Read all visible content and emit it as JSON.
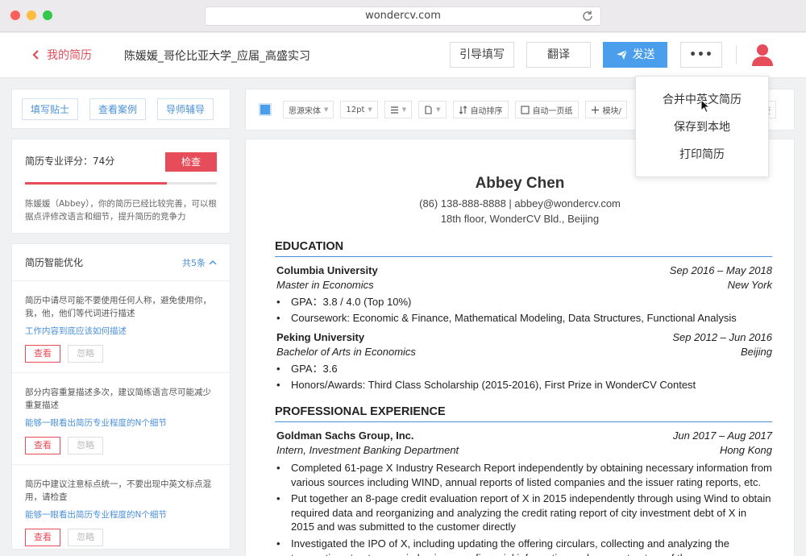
{
  "browser": {
    "url": "wondercv.com"
  },
  "header": {
    "back_label": "我的简历",
    "doc_title": "陈媛媛_哥伦比亚大学_应届_高盛实习",
    "guide_label": "引导填写",
    "translate_label": "翻译",
    "send_label": "发送",
    "more_label": "•••"
  },
  "dropdown": {
    "items": [
      "合并中英文简历",
      "保存到本地",
      "打印简历"
    ]
  },
  "left": {
    "tabs": [
      "填写贴士",
      "查看案例",
      "导师辅导"
    ],
    "score": {
      "label": "简历专业评分：74分",
      "value": 74,
      "check_label": "检查",
      "desc": "陈媛媛（Abbey），你的简历已经比较完善，可以根据点评修改语言和细节，提升简历的竞争力"
    },
    "optimize": {
      "title": "简历智能优化",
      "count": "共5条",
      "items": [
        {
          "text": "简历中请尽可能不要使用任何人称，避免使用你，我，他，他们等代词进行描述",
          "link": "工作内容到底应该如何描述",
          "view": "查看",
          "ignore": "忽略"
        },
        {
          "text": "部分内容重复描述多次，建议简练语言尽可能减少重复描述",
          "link": "能够一眼看出简历专业程度的N个细节",
          "view": "查看",
          "ignore": "忽略"
        },
        {
          "text": "简历中建议注意标点统一，不要出现中英文标点混用，请检查",
          "link": "能够一眼看出简历专业程度的N个细节",
          "view": "查看",
          "ignore": "忽略"
        }
      ]
    }
  },
  "toolbar": {
    "font": "思源宋体",
    "size": "12pt",
    "auto_sort": "自动排序",
    "auto_page": "自动一页纸",
    "module": "模块/",
    "last": "查"
  },
  "resume": {
    "name": "Abbey Chen",
    "contact1": "(86) 138-888-8888 | abbey@wondercv.com",
    "contact2": "18th floor, WonderCV Bld., Beijing",
    "education_title": "EDUCATION",
    "edu": [
      {
        "school": "Columbia University",
        "date": "Sep 2016 – May 2018",
        "degree": "Master in Economics",
        "place": "New York",
        "bullets": [
          "GPA：3.8 / 4.0 (Top 10%)",
          "Coursework: Economic & Finance, Mathematical Modeling, Data Structures, Functional Analysis"
        ]
      },
      {
        "school": "Peking University",
        "date": "Sep 2012 – Jun 2016",
        "degree": "Bachelor of Arts in Economics",
        "place": "Beijing",
        "bullets": [
          "GPA：3.6",
          "Honors/Awards: Third Class Scholarship (2015-2016), First Prize in WonderCV Contest"
        ]
      }
    ],
    "experience_title": "PROFESSIONAL EXPERIENCE",
    "exp": {
      "company": "Goldman Sachs Group, Inc.",
      "date": "Jun 2017 – Aug 2017",
      "role": "Intern, Investment Banking Department",
      "place": "Hong Kong",
      "bullets": [
        "Completed 61-page X Industry Research Report independently by obtaining necessary information from various sources including WIND, annual reports of listed companies and the issuer rating reports, etc.",
        "Put together an 8-page credit evaluation report of X in 2015 independently through using Wind to obtain required data and reorganizing and analyzing the credit rating report of city investment debt of X in 2015 and was submitted to the customer directly",
        "Investigated the IPO of X, including updating the offering circulars, collecting and analyzing the transaction structure, main businesses, financial information and group structure of the company"
      ]
    }
  }
}
